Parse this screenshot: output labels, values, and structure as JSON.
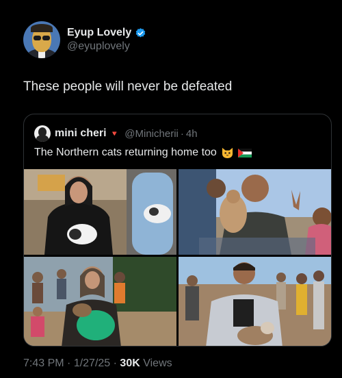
{
  "author": {
    "display_name": "Eyup Lovely",
    "handle": "@eyuplovely",
    "verified_icon": "verified-badge-icon",
    "accent_color": "#1d9bf0"
  },
  "tweet": {
    "text": "These people will never be defeated"
  },
  "quoted_tweet": {
    "display_name": "mini cheri",
    "heart_glyph": "🔻",
    "handle": "@Minicherii",
    "separator": "·",
    "time": "4h",
    "text": "The Northern cats returning home too",
    "emojis": [
      "cat-face-emoji",
      "palestine-flag-emoji"
    ],
    "photos": [
      "woman-holding-cat-photo",
      "man-holding-cat-photo",
      "woman-holding-cat-in-crowd-photo",
      "man-holding-cat-in-crowd-photo"
    ]
  },
  "meta": {
    "time": "7:43 PM",
    "sep1": " · ",
    "date": "1/27/25",
    "sep2": " · ",
    "views_count": "30K",
    "views_label": " Views"
  }
}
